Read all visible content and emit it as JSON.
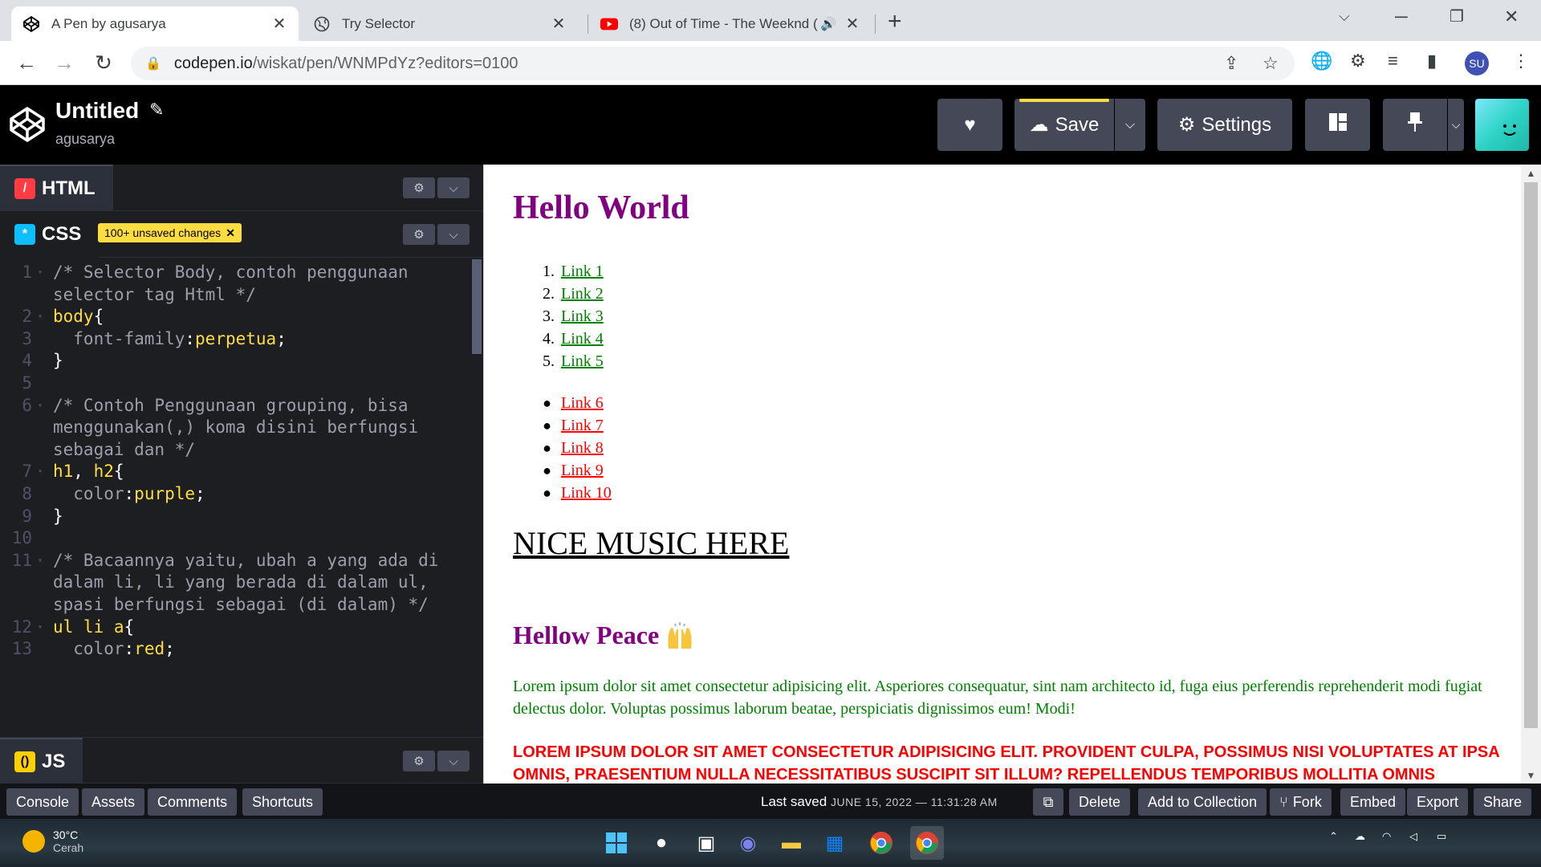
{
  "browser": {
    "tabs": [
      {
        "title": "A Pen by agusarya",
        "active": true,
        "favicon": "codepen-icon"
      },
      {
        "title": "Try Selector",
        "active": false,
        "favicon": "globe-icon"
      },
      {
        "title": "(8) Out of Time - The Weeknd (",
        "active": false,
        "favicon": "youtube-icon"
      }
    ],
    "url_host": "codepen.io",
    "url_path": "/wiskat/pen/WNMPdYz?editors=0100",
    "profile_initials": "SU"
  },
  "codepen": {
    "title": "Untitled",
    "user": "agusarya",
    "save_label": "Save",
    "settings_label": "Settings"
  },
  "editors": {
    "html_label": "HTML",
    "css_label": "CSS",
    "js_label": "JS",
    "unsaved_badge": "100+ unsaved changes",
    "code_lines": [
      {
        "n": "1",
        "fold": true,
        "parts": [
          {
            "t": "/* Selector Body, contoh penggunaan",
            "c": "c-comment"
          }
        ]
      },
      {
        "n": "",
        "fold": false,
        "parts": [
          {
            "t": "selector tag Html */",
            "c": "c-comment"
          }
        ]
      },
      {
        "n": "2",
        "fold": true,
        "parts": [
          {
            "t": "body",
            "c": "c-sel"
          },
          {
            "t": "{",
            "c": ""
          }
        ]
      },
      {
        "n": "3",
        "fold": false,
        "parts": [
          {
            "t": "  font-family",
            "c": "c-comment"
          },
          {
            "t": ":",
            "c": ""
          },
          {
            "t": "perpetua",
            "c": "c-val"
          },
          {
            "t": ";",
            "c": ""
          }
        ]
      },
      {
        "n": "4",
        "fold": false,
        "parts": [
          {
            "t": "}",
            "c": ""
          }
        ]
      },
      {
        "n": "5",
        "fold": false,
        "parts": []
      },
      {
        "n": "6",
        "fold": true,
        "parts": [
          {
            "t": "/* Contoh Penggunaan grouping, bisa",
            "c": "c-comment"
          }
        ]
      },
      {
        "n": "",
        "fold": false,
        "parts": [
          {
            "t": "menggunakan(,) koma disini berfungsi",
            "c": "c-comment"
          }
        ]
      },
      {
        "n": "",
        "fold": false,
        "parts": [
          {
            "t": "sebagai dan */",
            "c": "c-comment"
          }
        ]
      },
      {
        "n": "7",
        "fold": true,
        "parts": [
          {
            "t": "h1",
            "c": "c-sel"
          },
          {
            "t": ", ",
            "c": ""
          },
          {
            "t": "h2",
            "c": "c-sel"
          },
          {
            "t": "{",
            "c": ""
          }
        ]
      },
      {
        "n": "8",
        "fold": false,
        "parts": [
          {
            "t": "  color",
            "c": "c-comment"
          },
          {
            "t": ":",
            "c": ""
          },
          {
            "t": "purple",
            "c": "c-val"
          },
          {
            "t": ";",
            "c": ""
          }
        ]
      },
      {
        "n": "9",
        "fold": false,
        "parts": [
          {
            "t": "}",
            "c": ""
          }
        ]
      },
      {
        "n": "10",
        "fold": false,
        "parts": []
      },
      {
        "n": "11",
        "fold": true,
        "parts": [
          {
            "t": "/* Bacaannya yaitu, ubah a yang ada di",
            "c": "c-comment"
          }
        ]
      },
      {
        "n": "",
        "fold": false,
        "parts": [
          {
            "t": "dalam li, li yang berada di dalam ul,",
            "c": "c-comment"
          }
        ]
      },
      {
        "n": "",
        "fold": false,
        "parts": [
          {
            "t": "spasi berfungsi sebagai (di dalam) */",
            "c": "c-comment"
          }
        ]
      },
      {
        "n": "12",
        "fold": true,
        "parts": [
          {
            "t": "ul li a",
            "c": "c-sel"
          },
          {
            "t": "{",
            "c": ""
          }
        ]
      },
      {
        "n": "13",
        "fold": false,
        "parts": [
          {
            "t": "  color",
            "c": "c-comment"
          },
          {
            "t": ":",
            "c": ""
          },
          {
            "t": "red",
            "c": "c-val"
          },
          {
            "t": ";",
            "c": ""
          }
        ]
      }
    ]
  },
  "preview": {
    "h1": "Hello World",
    "ordered_links": [
      "Link 1",
      "Link 2",
      "Link 3",
      "Link 4",
      "Link 5"
    ],
    "unordered_links": [
      "Link 6",
      "Link 7",
      "Link 8",
      "Link 9",
      "Link 10"
    ],
    "music_heading": "NICE MUSIC HERE",
    "h2": "Hellow Peace",
    "paragraph": "Lorem ipsum dolor sit amet consectetur adipisicing elit. Asperiores consequatur, sint nam architecto id, fuga eius perferendis reprehenderit modi fugiat delectus dolor. Voluptas possimus laborum beatae, perspiciatis dignissimos eum! Modi!",
    "caps_paragraph": "LOREM IPSUM DOLOR SIT AMET CONSECTETUR ADIPISICING ELIT. PROVIDENT CULPA, POSSIMUS NISI VOLUPTATES AT IPSA OMNIS, PRAESENTIUM NULLA NECESSITATIBUS SUSCIPIT SIT ILLUM? REPELLENDUS TEMPORIBUS MOLLITIA OMNIS"
  },
  "footer": {
    "console": "Console",
    "assets": "Assets",
    "comments": "Comments",
    "shortcuts": "Shortcuts",
    "last_saved_label": "Last saved",
    "last_saved_date": "JUNE 15, 2022 — 11:31:28 AM",
    "delete": "Delete",
    "add_to_collection": "Add to Collection",
    "fork": "Fork",
    "embed": "Embed",
    "export": "Export",
    "share": "Share"
  },
  "taskbar": {
    "temperature": "30°C",
    "condition": "Cerah"
  },
  "colors": {
    "codepen_dark": "#1d1e22",
    "button_gray": "#444857",
    "accent_yellow": "#ffdd40",
    "heading_purple": "#800080",
    "link_green": "#008000",
    "link_red": "#ff0000"
  }
}
